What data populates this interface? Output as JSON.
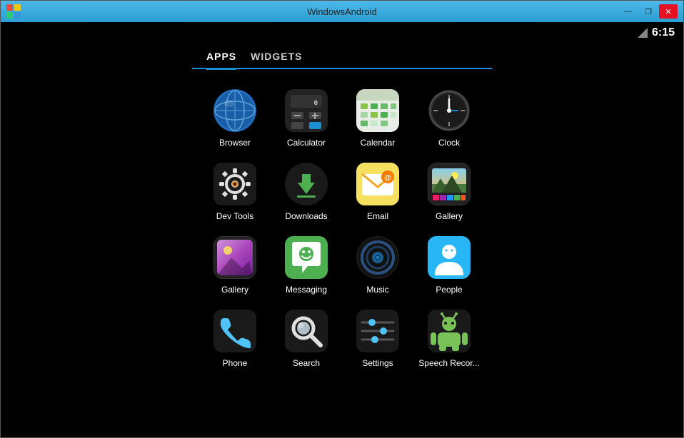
{
  "window": {
    "title": "WindowsAndroid",
    "controls": {
      "minimize": "—",
      "restore": "❐",
      "close": "✕"
    }
  },
  "status_bar": {
    "time": "6:15"
  },
  "tabs": [
    {
      "label": "APPS",
      "active": true
    },
    {
      "label": "WIDGETS",
      "active": false
    }
  ],
  "apps": [
    {
      "name": "Browser",
      "icon": "browser"
    },
    {
      "name": "Calculator",
      "icon": "calculator"
    },
    {
      "name": "Calendar",
      "icon": "calendar"
    },
    {
      "name": "Clock",
      "icon": "clock"
    },
    {
      "name": "Dev Tools",
      "icon": "devtools"
    },
    {
      "name": "Downloads",
      "icon": "downloads"
    },
    {
      "name": "Email",
      "icon": "email"
    },
    {
      "name": "Gallery",
      "icon": "gallery2"
    },
    {
      "name": "Gallery",
      "icon": "gallery"
    },
    {
      "name": "Messaging",
      "icon": "messaging"
    },
    {
      "name": "Music",
      "icon": "music"
    },
    {
      "name": "People",
      "icon": "people"
    },
    {
      "name": "Phone",
      "icon": "phone"
    },
    {
      "name": "Search",
      "icon": "search"
    },
    {
      "name": "Settings",
      "icon": "settings"
    },
    {
      "name": "Speech Recor...",
      "icon": "speechrecog"
    }
  ],
  "colors": {
    "titlebar": "#4db8e8",
    "background": "#000000",
    "text_primary": "#ffffff",
    "accent": "#1a8fd1"
  }
}
